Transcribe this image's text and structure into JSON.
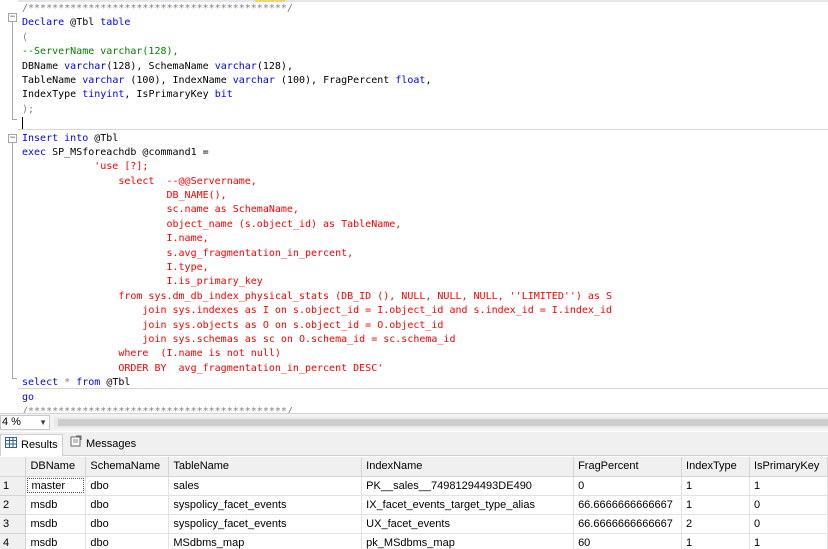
{
  "editor": {
    "lines": [
      [
        [
          "/*******************************************/",
          "g"
        ]
      ],
      [
        [
          "Declare",
          "k"
        ],
        [
          " @Tbl ",
          ""
        ],
        [
          "table",
          "k"
        ]
      ],
      [
        [
          "(",
          "g"
        ]
      ],
      [
        [
          "--ServerName varchar(128),",
          "c"
        ]
      ],
      [
        [
          "DBName ",
          ""
        ],
        [
          "varchar",
          "k"
        ],
        [
          "(128), SchemaName ",
          ""
        ],
        [
          "varchar",
          "k"
        ],
        [
          "(128),",
          ""
        ]
      ],
      [
        [
          "TableName ",
          ""
        ],
        [
          "varchar",
          "k"
        ],
        [
          " (100), IndexName ",
          ""
        ],
        [
          "varchar",
          "k"
        ],
        [
          " (100), FragPercent ",
          ""
        ],
        [
          "float",
          "k"
        ],
        [
          ",",
          ""
        ]
      ],
      [
        [
          "IndexType ",
          ""
        ],
        [
          "tinyint",
          "k"
        ],
        [
          ", IsPrimaryKey ",
          ""
        ],
        [
          "bit",
          "k"
        ]
      ],
      [
        [
          ");",
          "g"
        ]
      ],
      [
        [
          "",
          "caret"
        ]
      ],
      [
        [
          "Insert",
          "k"
        ],
        [
          " ",
          ""
        ],
        [
          "into",
          "k"
        ],
        [
          " @Tbl",
          ""
        ]
      ],
      [
        [
          "exec",
          "k"
        ],
        [
          " SP_MSforeachdb @command1 =",
          ""
        ]
      ],
      [
        [
          "            'use [?];",
          "s"
        ]
      ],
      [
        [
          "                select  --@@Servername,",
          "s"
        ]
      ],
      [
        [
          "                        DB_NAME(),",
          "s"
        ]
      ],
      [
        [
          "                        sc.name as SchemaName,",
          "s"
        ]
      ],
      [
        [
          "                        object_name (s.object_id) as TableName,",
          "s"
        ]
      ],
      [
        [
          "                        I.name,",
          "s"
        ]
      ],
      [
        [
          "                        s.avg_fragmentation_in_percent,",
          "s"
        ]
      ],
      [
        [
          "                        I.type,",
          "s"
        ]
      ],
      [
        [
          "                        I.is_primary_key",
          "s"
        ]
      ],
      [
        [
          "                from sys.dm_db_index_physical_stats (DB_ID (), NULL, NULL, NULL, ''LIMITED'') as S",
          "s"
        ]
      ],
      [
        [
          "                    join sys.indexes as I on s.object_id = I.object_id and s.index_id = I.index_id",
          "s"
        ]
      ],
      [
        [
          "                    join sys.objects as O on s.object_id = O.object_id",
          "s"
        ]
      ],
      [
        [
          "                    join sys.schemas as sc on O.schema_id = sc.schema_id",
          "s"
        ]
      ],
      [
        [
          "                where  (I.name is not null)",
          "s"
        ]
      ],
      [
        [
          "                ORDER BY  avg_fragmentation_in_percent DESC'",
          "s"
        ]
      ],
      [
        [
          "select",
          "k"
        ],
        [
          " ",
          ""
        ],
        [
          "*",
          "g"
        ],
        [
          " ",
          ""
        ],
        [
          "from",
          "k"
        ],
        [
          " @Tbl",
          ""
        ]
      ],
      [
        [
          "go",
          "k"
        ]
      ],
      [
        [
          "/*******************************************/",
          "g"
        ]
      ]
    ]
  },
  "zoom": {
    "value": "4 %",
    "arrow": "▼"
  },
  "tabs": {
    "results": "Results",
    "messages": "Messages"
  },
  "grid": {
    "columns": [
      "",
      "DBName",
      "SchemaName",
      "TableName",
      "IndexName",
      "FragPercent",
      "IndexType",
      "IsPrimaryKey"
    ],
    "rows": [
      [
        "1",
        "master",
        "dbo",
        "sales",
        "PK__sales__74981294493DE490",
        "0",
        "1",
        "1"
      ],
      [
        "2",
        "msdb",
        "dbo",
        "syspolicy_facet_events",
        "IX_facet_events_target_type_alias",
        "66.6666666666667",
        "1",
        "0"
      ],
      [
        "3",
        "msdb",
        "dbo",
        "syspolicy_facet_events",
        "UX_facet_events",
        "66.6666666666667",
        "2",
        "0"
      ],
      [
        "4",
        "msdb",
        "dbo",
        "MSdbms_map",
        "pk_MSdbms_map",
        "60",
        "1",
        "1"
      ]
    ]
  }
}
